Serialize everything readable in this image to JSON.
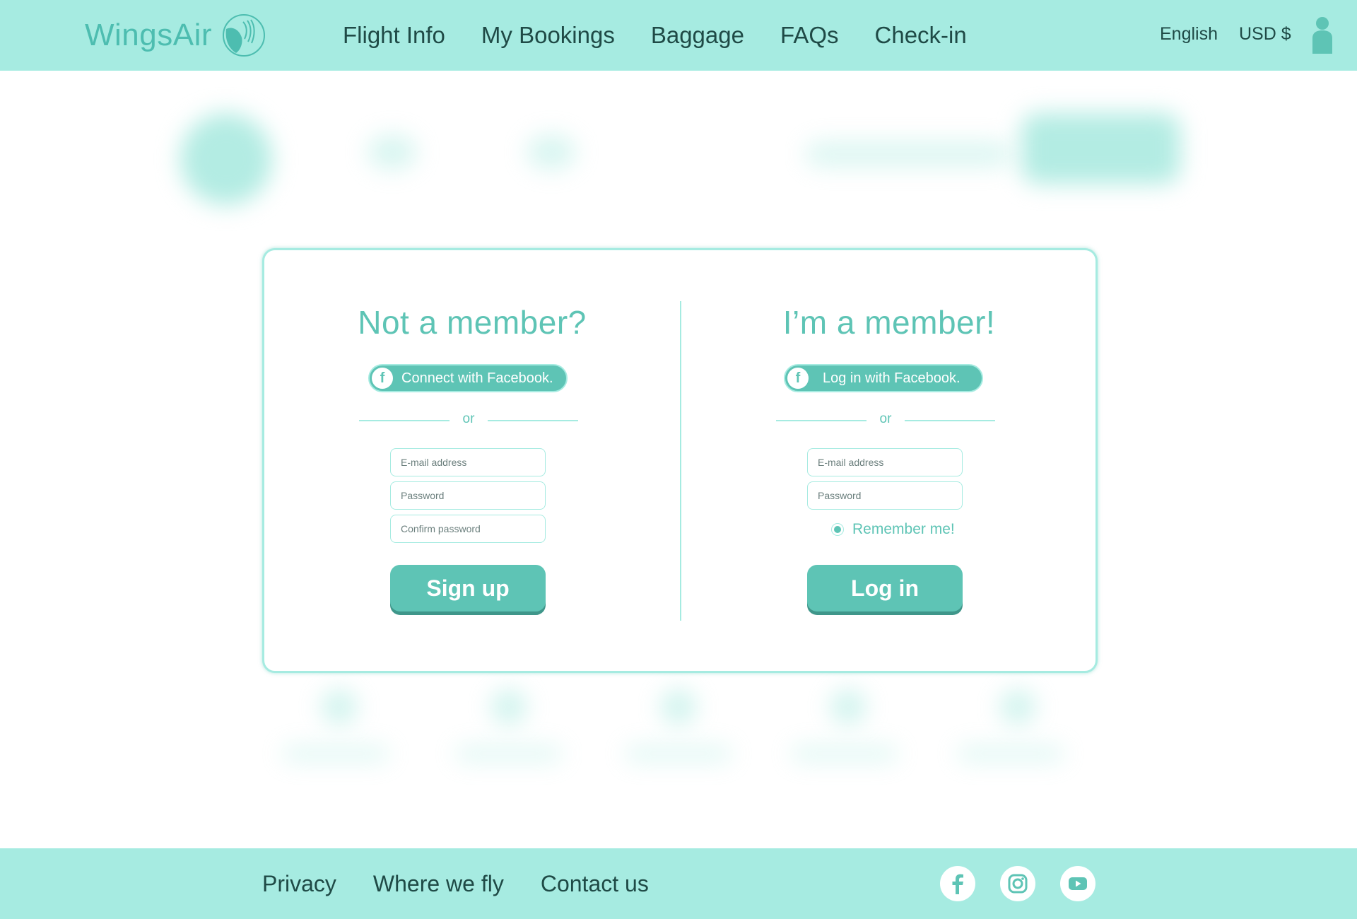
{
  "brand": {
    "name": "WingsAir"
  },
  "nav": {
    "items": [
      {
        "label": "Flight Info"
      },
      {
        "label": "My Bookings"
      },
      {
        "label": "Baggage"
      },
      {
        "label": "FAQs"
      },
      {
        "label": "Check-in"
      }
    ],
    "language": "English",
    "currency": "USD $",
    "user_icon": "user-icon"
  },
  "signup": {
    "title": "Not a member?",
    "facebook_label": "Connect with Facebook.",
    "or_label": "or",
    "email_placeholder": "E-mail address",
    "password_placeholder": "Password",
    "confirm_placeholder": "Confirm password",
    "submit_label": "Sign up"
  },
  "login": {
    "title": "I’m a member!",
    "facebook_label": "Log in with Facebook.",
    "or_label": "or",
    "email_placeholder": "E-mail address",
    "password_placeholder": "Password",
    "remember_label": "Remember me!",
    "remember_checked": true,
    "submit_label": "Log in"
  },
  "footer": {
    "links": [
      {
        "label": "Privacy"
      },
      {
        "label": "Where we fly"
      },
      {
        "label": "Contact us"
      }
    ],
    "social_icons": [
      "facebook-icon",
      "instagram-icon",
      "youtube-icon"
    ]
  },
  "colors": {
    "header_bg": "#a6ebe1",
    "accent": "#5ec4b5",
    "accent_dark": "#3f968a",
    "text_dark": "#1f4a46"
  }
}
